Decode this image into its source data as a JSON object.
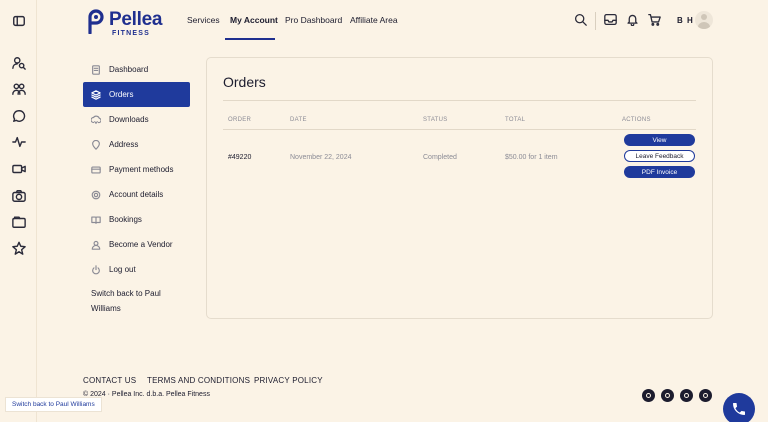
{
  "rail_icons": [
    "sidebar-toggle-icon",
    "user-search-icon",
    "users-icon",
    "chat-icon",
    "activity-icon",
    "video-icon",
    "camera-icon",
    "folder-icon",
    "star-icon"
  ],
  "brand": {
    "name": "Pellea",
    "tagline": "FITNESS"
  },
  "nav": {
    "services": "Services",
    "my_account": "My Account",
    "pro_dashboard": "Pro Dashboard",
    "affiliate_area": "Affiliate Area"
  },
  "user": {
    "initials": "B H"
  },
  "account_menu": [
    {
      "label": "Dashboard",
      "icon": "dashboard-icon"
    },
    {
      "label": "Orders",
      "icon": "orders-icon",
      "active": true
    },
    {
      "label": "Downloads",
      "icon": "download-icon"
    },
    {
      "label": "Address",
      "icon": "location-icon"
    },
    {
      "label": "Payment methods",
      "icon": "credit-card-icon"
    },
    {
      "label": "Account details",
      "icon": "settings-icon"
    },
    {
      "label": "Bookings",
      "icon": "book-icon"
    },
    {
      "label": "Become a Vendor",
      "icon": "user-icon"
    },
    {
      "label": "Log out",
      "icon": "power-icon"
    }
  ],
  "switch_back": "Switch back to Paul Williams",
  "orders": {
    "title": "Orders",
    "columns": {
      "order": "ORDER",
      "date": "DATE",
      "status": "STATUS",
      "total": "TOTAL",
      "actions": "ACTIONS"
    },
    "rows": [
      {
        "order": "#49220",
        "date": "November 22, 2024",
        "status": "Completed",
        "total": "$50.00 for 1 item",
        "actions": {
          "view": "View",
          "feedback": "Leave Feedback",
          "invoice": "PDF Invoice"
        }
      }
    ]
  },
  "footer": {
    "contact": "CONTACT US",
    "terms": "TERMS AND CONDITIONS",
    "privacy": "PRIVACY POLICY",
    "copyright": "© 2024 · Pellea Inc. d.b.a. Pellea Fitness",
    "social": [
      "facebook-icon",
      "instagram-icon",
      "youtube-icon",
      "twitter-icon"
    ]
  },
  "toast": "Switch back to Paul Williams",
  "colors": {
    "accent": "#1f3a9c",
    "background": "#fbf3e6",
    "brand": "#1f2f8f"
  }
}
